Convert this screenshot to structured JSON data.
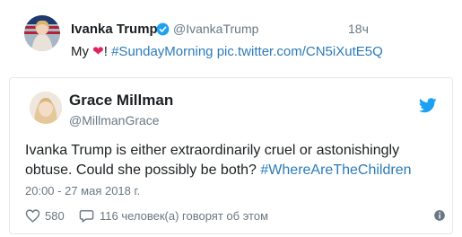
{
  "quoted_tweet": {
    "author_name": "Ivanka Trump",
    "author_handle": "@IvankaTrump",
    "timestamp": "18ч",
    "text_prefix": "My ",
    "text_after_heart": "! ",
    "hashtag": "#SundayMorning",
    "link": "pic.twitter.com/CN5iXutE5Q",
    "verified": true
  },
  "embedded_tweet": {
    "author_name": "Grace Millman",
    "author_handle": "@MillmanGrace",
    "text": "Ivanka Trump is either extraordinarily cruel or astonishingly obtuse. Could she possibly be both? ",
    "hashtag": "#WhereAreTheChildren",
    "date": "20:00 - 27 мая 2018 г.",
    "likes": "580",
    "replies_label": "116 человек(а) говорят об этом"
  },
  "colors": {
    "link": "#2b7bb9",
    "heart": "#e0245e",
    "twitter_blue": "#1da1f2",
    "verified": "#1da1f2",
    "muted": "#697882"
  },
  "icons": {
    "verified": "verified-badge-icon",
    "bird": "twitter-bird-icon",
    "heart": "heart-icon",
    "like": "like-heart-outline-icon",
    "reply": "speech-bubble-icon",
    "info": "info-icon"
  }
}
